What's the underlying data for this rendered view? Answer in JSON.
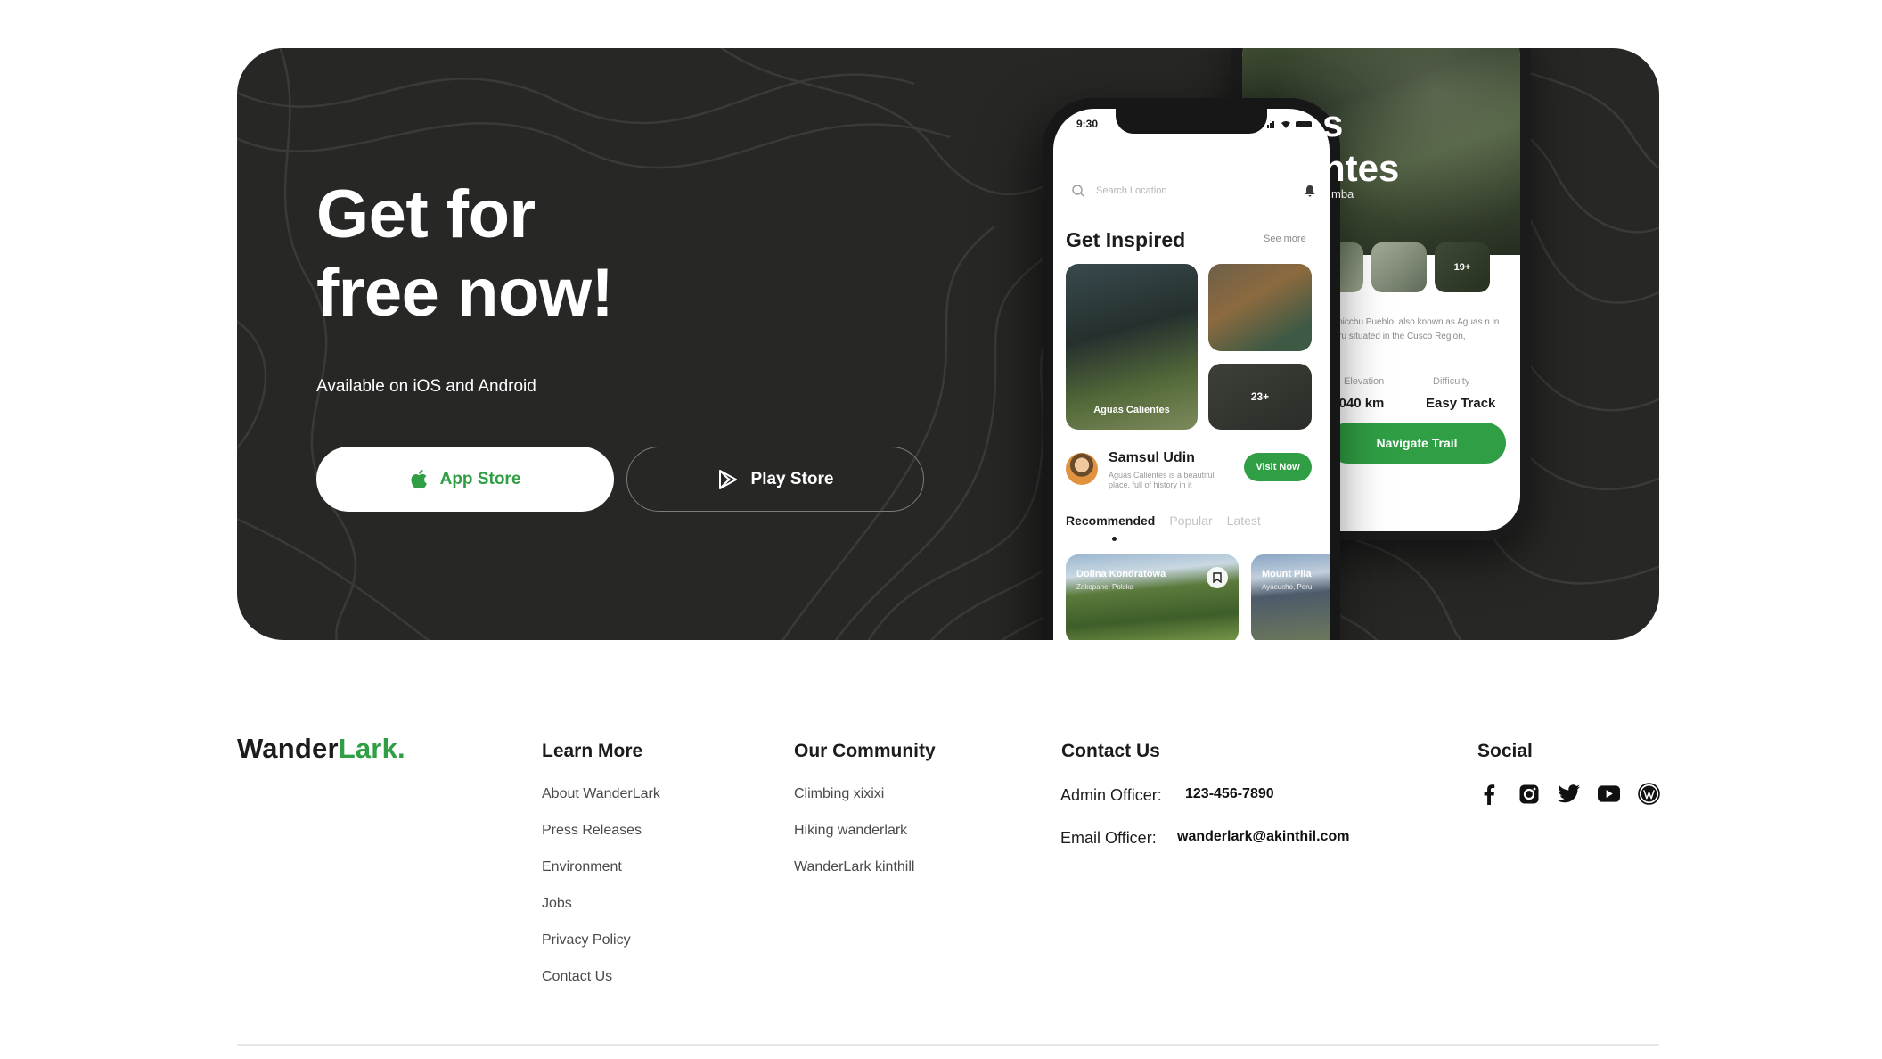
{
  "hero": {
    "title_line1": "Get for",
    "title_line2": "free now!",
    "subtitle": "Available on iOS and Android",
    "app_store_label": "App Store",
    "play_store_label": "Play Store",
    "accent_color": "#2f9e44"
  },
  "phone_back": {
    "title_line1": "s",
    "title_line2": "ntes",
    "subtitle": "mba",
    "thumb_count": "19+",
    "description": "uppicchu Pueblo, also known as Aguas n in Peru situated in the Cusco Region,",
    "stat1_label": "Elevation",
    "stat1_value": "2,040 km",
    "stat2_label": "Difficulty",
    "stat2_value": "Easy Track",
    "navigate_label": "Navigate Trail"
  },
  "phone_front": {
    "time": "9:30",
    "search_placeholder": "Search Location",
    "heading": "Get Inspired",
    "see_more": "See more",
    "card_big_label": "Aguas Calientes",
    "card_small_count": "23+",
    "author_name": "Samsul Udin",
    "author_desc": "Aguas Calientes is a beautiful place, full of history in it",
    "visit_label": "Visit Now",
    "tabs": [
      "Recommended",
      "Popular",
      "Latest"
    ],
    "rec_cards": [
      {
        "title": "Dolina Kondratowa",
        "location": "Zakopane, Polska"
      },
      {
        "title": "Mount Pila",
        "location": "Ayacucho, Peru"
      }
    ]
  },
  "footer": {
    "logo_main": "Wander",
    "logo_accent": "Lark.",
    "learn_more": {
      "heading": "Learn More",
      "links": [
        "About WanderLark",
        "Press Releases",
        "Environment",
        "Jobs",
        "Privacy Policy",
        "Contact Us"
      ]
    },
    "community": {
      "heading": "Our Community",
      "links": [
        "Climbing xixixi",
        "Hiking wanderlark",
        "WanderLark kinthill"
      ]
    },
    "contact": {
      "heading": "Contact Us",
      "admin_label": "Admin Officer:",
      "admin_value": "123-456-7890",
      "email_label": "Email Officer:",
      "email_value": "wanderlark@akinthil.com"
    },
    "social": {
      "heading": "Social",
      "icons": [
        "facebook-icon",
        "instagram-icon",
        "twitter-icon",
        "youtube-icon",
        "wordpress-icon"
      ]
    }
  }
}
